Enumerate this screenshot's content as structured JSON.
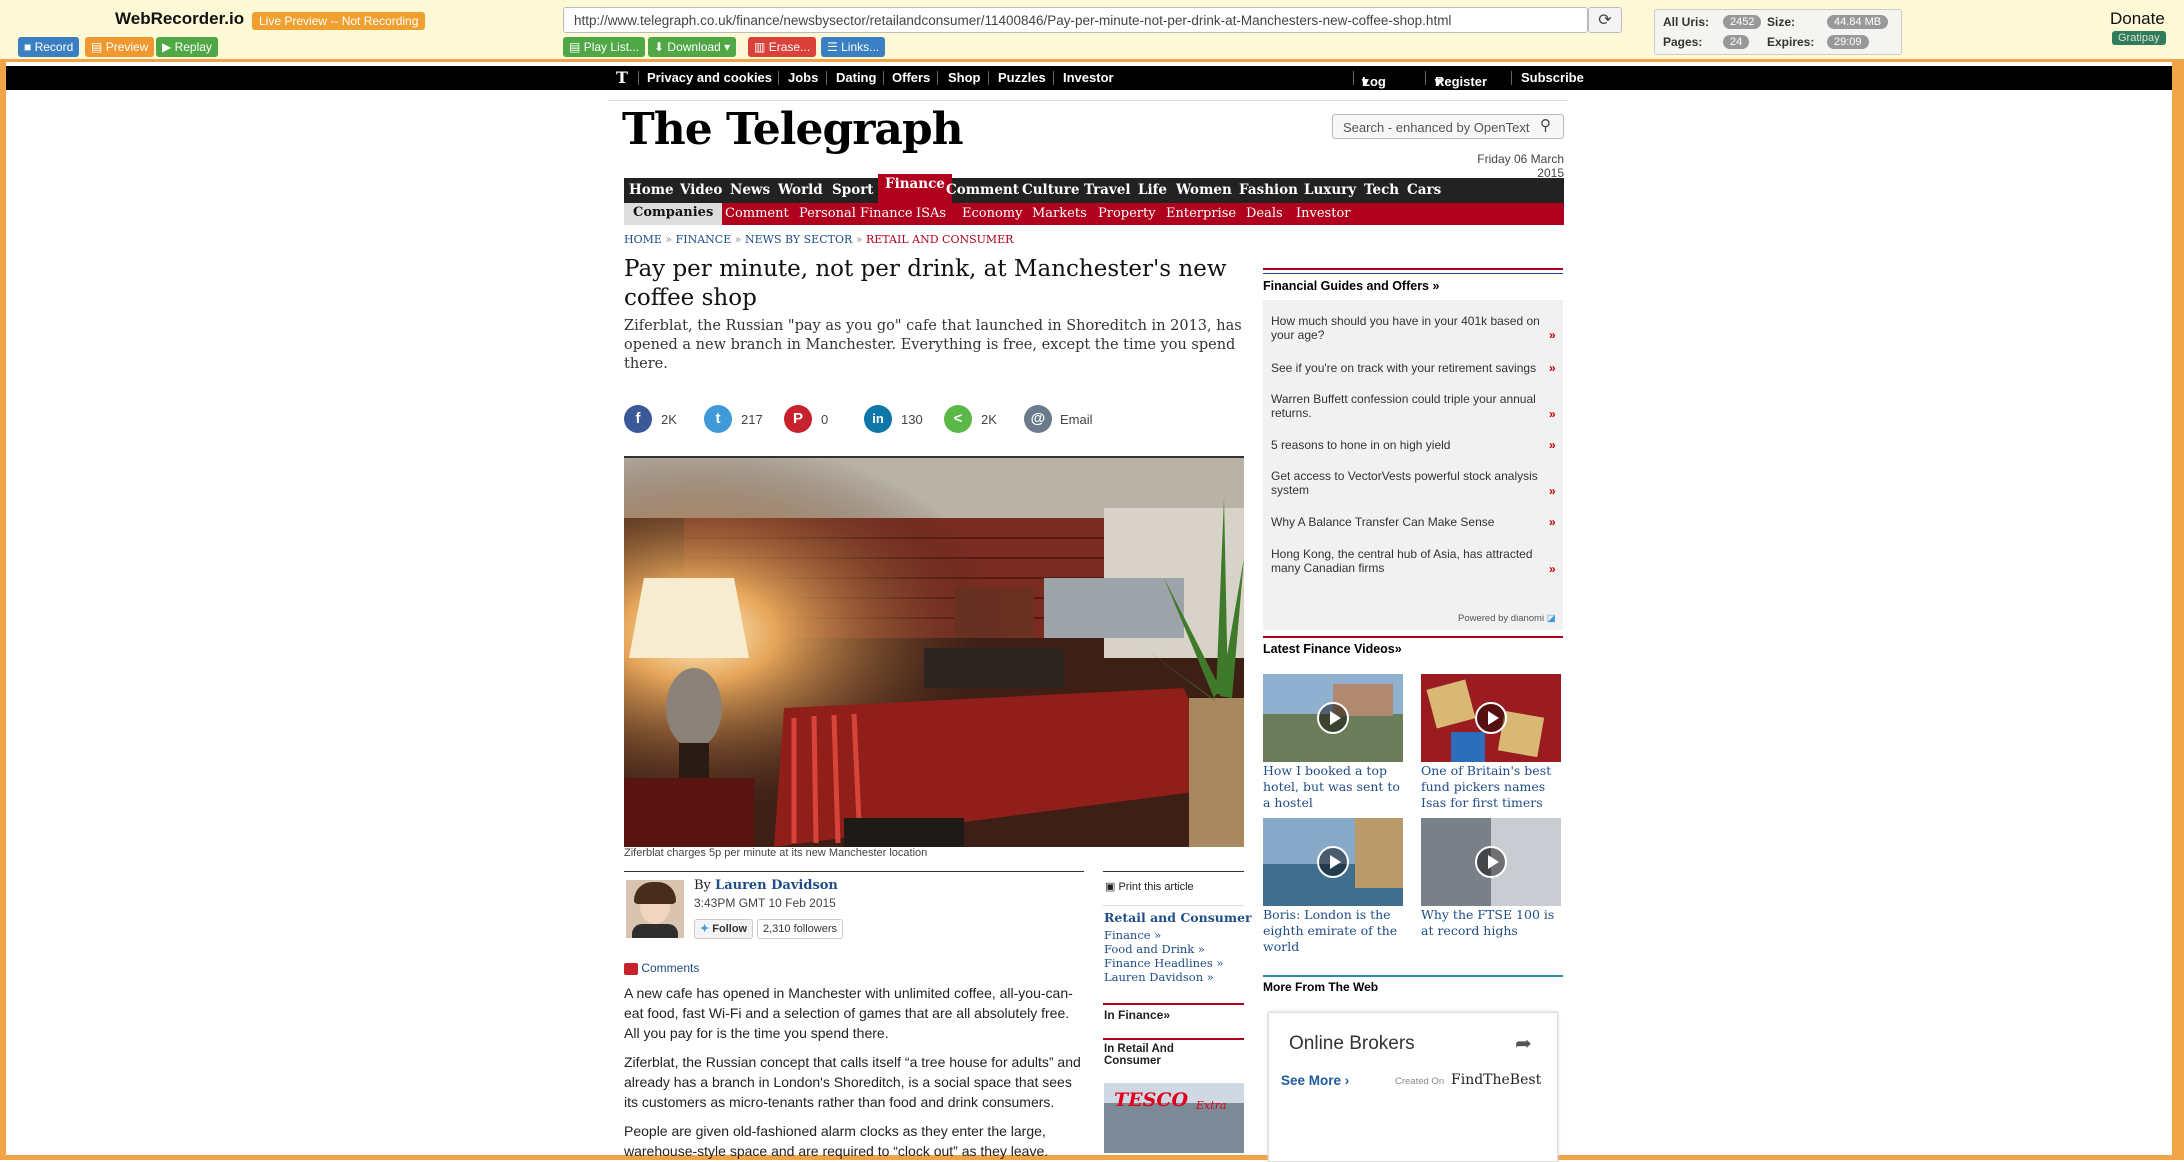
{
  "recorder": {
    "title": "WebRecorder.io",
    "status": "Live Preview -- Not Recording",
    "record": "Record",
    "preview": "Preview",
    "replay": "Replay",
    "playlist": "Play List...",
    "download": "Download",
    "erase": "Erase...",
    "links": "Links...",
    "url": "http://www.telegraph.co.uk/finance/newsbysector/retailandconsumer/11400846/Pay-per-minute-not-per-drink-at-Manchesters-new-coffee-shop.html",
    "stats": {
      "all_uris_label": "All Uris:",
      "all_uris": "2452",
      "size_label": "Size:",
      "size": "44.84 MB",
      "pages_label": "Pages:",
      "pages": "24",
      "expires_label": "Expires:",
      "expires": "29:09"
    },
    "donate": "Donate",
    "gratipay": "Gratipay"
  },
  "topbar": {
    "logo_letter": "T",
    "links": [
      "Privacy and cookies",
      "Jobs",
      "Dating",
      "Offers",
      "Shop",
      "Puzzles",
      "Investor"
    ],
    "login": "Log in",
    "register": "Register",
    "subscribe": "Subscribe"
  },
  "masthead": {
    "logo": "The Telegraph",
    "search_placeholder": "Search - enhanced by OpenText",
    "date": "Friday 06 March 2015"
  },
  "nav_primary": [
    "Home",
    "Video",
    "News",
    "World",
    "Sport",
    "Finance",
    "Comment",
    "Culture",
    "Travel",
    "Life",
    "Women",
    "Fashion",
    "Luxury",
    "Tech",
    "Cars"
  ],
  "nav_secondary": [
    "Companies",
    "Comment",
    "Personal Finance",
    "ISAs",
    "Economy",
    "Markets",
    "Property",
    "Enterprise",
    "Deals",
    "Investor"
  ],
  "breadcrumb": [
    "HOME",
    "FINANCE",
    "NEWS BY SECTOR",
    "RETAIL AND CONSUMER"
  ],
  "article": {
    "headline": "Pay per minute, not per drink, at Manchester's new coffee shop",
    "standfirst": "Ziferblat, the Russian \"pay as you go\" cafe that launched in Shoreditch in 2013, has opened a new branch in Manchester. Everything is free, except the time you spend there.",
    "caption": "Ziferblat charges 5p per minute at its new Manchester location",
    "by": "By",
    "author": "Lauren Davidson",
    "timestamp": "3:43PM GMT 10 Feb 2015",
    "follow": "Follow",
    "followers": "2,310 followers",
    "comments": "Comments",
    "paragraphs": [
      "A new cafe has opened in Manchester with unlimited coffee, all-you-can-eat food, fast Wi-Fi and a selection of games that are all absolutely free. All you pay for is the time you spend there.",
      "Ziferblat, the Russian concept that calls itself “a tree house for adults” and already has a branch in London's Shoreditch, is a social space that sees its customers as micro-tenants rather than food and drink consumers.",
      "People are given old-fashioned alarm clocks as they enter the large, warehouse-style space and are required to “clock out” as they leave."
    ]
  },
  "share": [
    {
      "network": "facebook",
      "count": "2K",
      "color": "#3b5998",
      "glyph": "f"
    },
    {
      "network": "twitter",
      "count": "217",
      "color": "#4099d8",
      "glyph": "t"
    },
    {
      "network": "pinterest",
      "count": "0",
      "color": "#c8232c",
      "glyph": "P"
    },
    {
      "network": "linkedin",
      "count": "130",
      "color": "#0e76a8",
      "glyph": "in"
    },
    {
      "network": "share",
      "count": "2K",
      "color": "#5ab946",
      "glyph": "<"
    },
    {
      "network": "email",
      "count": "Email",
      "color": "#6b7b8c",
      "glyph": "@"
    }
  ],
  "article_tools": {
    "print": "Print this article",
    "related_head": "Retail and Consumer",
    "related_links": [
      "Finance »",
      "Food and Drink »",
      "Finance Headlines »",
      "Lauren Davidson »"
    ],
    "in_finance": "In Finance»",
    "in_retail": "In Retail And Consumer"
  },
  "sidebar": {
    "guides_head": "Financial Guides and Offers »",
    "offers": [
      "How much should you have in your 401k based on your age?",
      "See if you're on track with your retirement savings",
      "Warren Buffett confession could triple your annual returns.",
      "5 reasons to hone in on high yield",
      "Get access to VectorVests powerful stock analysis system",
      "Why A Balance Transfer Can Make Sense",
      "Hong Kong, the central hub of Asia, has attracted many Canadian firms"
    ],
    "powered": "Powered by dianomi",
    "videos_head": "Latest Finance Videos»",
    "videos": [
      "How I booked a top hotel, but was sent to a hostel",
      "One of Britain's best fund pickers names Isas for first timers",
      "Boris: London is the eighth emirate of the world",
      "Why the FTSE 100 is at record highs"
    ],
    "more_head": "More From The Web",
    "brokers_title": "Online Brokers",
    "see_more": "See More ›",
    "created_on": "Created On",
    "findthebest": "FindTheBest"
  }
}
